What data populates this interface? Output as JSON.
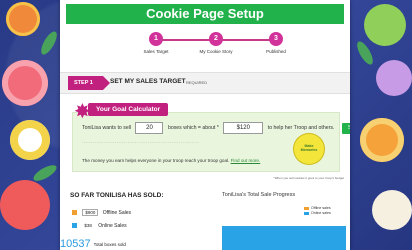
{
  "header": {
    "title": "Cookie Page Setup"
  },
  "steps": [
    {
      "number": "1",
      "label": "Sales Target"
    },
    {
      "number": "2",
      "label": "My Cookie Story"
    },
    {
      "number": "3",
      "label": "Published"
    }
  ],
  "step_bar": {
    "tag": "STEP 1",
    "title": "SET MY SALES TARGET",
    "required": "REQUIRED"
  },
  "calculator": {
    "title": "Your Goal Calculator",
    "text_before": "ToniLisa  wants to sell",
    "boxes": "20",
    "text_mid": "boxes which = about *",
    "amount": "$120",
    "text_after": "to help her Troop and others.",
    "save_label": "Save",
    "seal_text": "Make Memories",
    "money_text": "The money you earn helps everyone in your troop reach your troop goal.",
    "money_link": "Find out more.",
    "note": "*When you sell cookies it goes to your troop's budget"
  },
  "so_far": {
    "heading": "SO FAR TONILISA HAS SOLD:",
    "offline": {
      "value": "$900",
      "label": "Offline Sales",
      "color": "#f0a030"
    },
    "online": {
      "value": "$38",
      "label": "Online Sales",
      "color": "#2aa3e6"
    },
    "total_value": "10537",
    "total_label": "Total boxes sold"
  },
  "progress": {
    "title": "ToniLisa's Total Sale Progress",
    "legend": [
      {
        "label": "Offline sales",
        "color": "#f0a030"
      },
      {
        "label": "Online sales",
        "color": "#2aa3e6"
      }
    ]
  }
}
